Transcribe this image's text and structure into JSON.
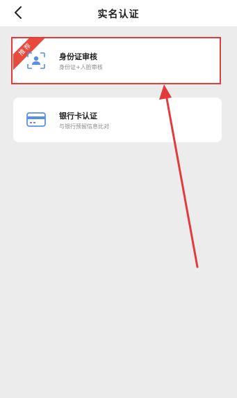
{
  "header": {
    "title": "实名认证",
    "back_icon": "chevron-left-icon"
  },
  "cards": [
    {
      "title": "身份证审核",
      "subtitle": "身份证+人脸审核",
      "badge": "推荐",
      "icon": "face-scan-icon"
    },
    {
      "title": "银行卡认证",
      "subtitle": "与银行预留信息比对",
      "icon": "bank-card-icon"
    }
  ],
  "colors": {
    "accent_blue": "#5a8fe6",
    "highlight_red": "#e23b3b",
    "badge_red": "#e94a3c",
    "background": "#ececec"
  }
}
